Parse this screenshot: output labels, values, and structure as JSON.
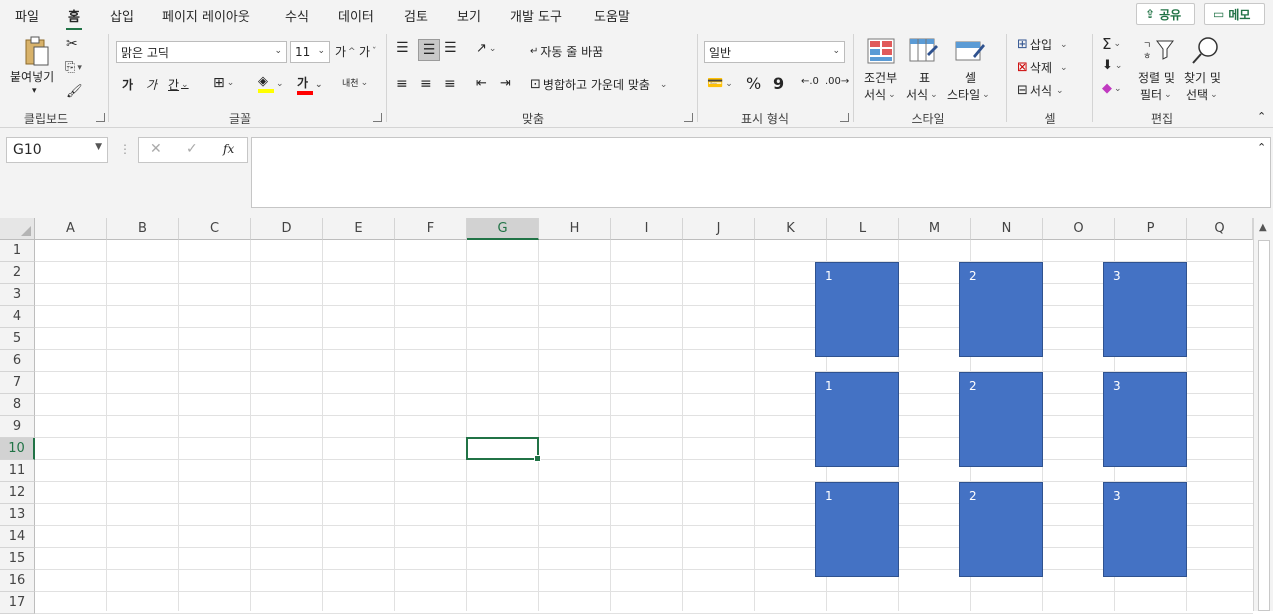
{
  "menu": {
    "tabs": [
      "파일",
      "홈",
      "삽입",
      "페이지 레이아웃",
      "수식",
      "데이터",
      "검토",
      "보기",
      "개발 도구",
      "도움말"
    ],
    "active": 1,
    "share_label": "공유",
    "memo_label": "메모"
  },
  "ribbon": {
    "clipboard": {
      "paste_label": "붙여넣기",
      "group_label": "클립보드"
    },
    "font": {
      "name": "맑은 고딕",
      "size": "11",
      "grow": "가",
      "shrink": "가",
      "bold": "가",
      "italic": "가",
      "underline": "간",
      "font_color": "가",
      "phonetic": "내천",
      "group_label": "글꼴"
    },
    "alignment": {
      "wrap_text": "자동 줄 바꿈",
      "merge_center": "병합하고 가운데 맞춤",
      "group_label": "맞춤"
    },
    "number": {
      "format": "일반",
      "percent": "%",
      "comma": "9",
      "group_label": "표시 형식"
    },
    "styles": {
      "conditional": [
        "조건부",
        "서식"
      ],
      "table": [
        "표",
        "서식"
      ],
      "cell": [
        "셀",
        "스타일"
      ],
      "group_label": "스타일"
    },
    "cells": {
      "insert": "삽입",
      "delete": "삭제",
      "format": "서식",
      "group_label": "셀"
    },
    "editing": {
      "sort": [
        "정렬 및",
        "필터"
      ],
      "find": [
        "찾기 및",
        "선택"
      ],
      "group_label": "편집"
    }
  },
  "formula_bar": {
    "name_box": "G10",
    "fx": "fx",
    "formula": ""
  },
  "sheet": {
    "columns": [
      "A",
      "B",
      "C",
      "D",
      "E",
      "F",
      "G",
      "H",
      "I",
      "J",
      "K",
      "L",
      "M",
      "N",
      "O",
      "P",
      "Q"
    ],
    "rows": [
      "1",
      "2",
      "3",
      "4",
      "5",
      "6",
      "7",
      "8",
      "9",
      "10",
      "11",
      "12",
      "13",
      "14",
      "15",
      "16",
      "17"
    ],
    "selected_column": "G",
    "selected_row": "10",
    "shapes": [
      {
        "label": "1"
      },
      {
        "label": "2"
      },
      {
        "label": "3"
      },
      {
        "label": "1"
      },
      {
        "label": "2"
      },
      {
        "label": "3"
      },
      {
        "label": "1"
      },
      {
        "label": "2"
      },
      {
        "label": "3"
      }
    ]
  },
  "colors": {
    "accent": "#217346",
    "shape_fill": "#4472c4",
    "shape_border": "#2f528f"
  }
}
